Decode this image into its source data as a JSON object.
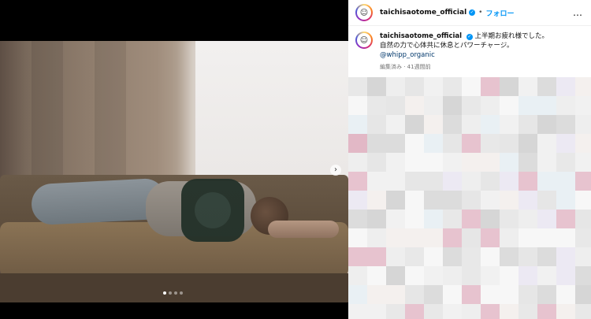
{
  "post": {
    "username": "taichisaotome_official",
    "separator": "•",
    "follow_label": "フォロー",
    "more_icon": "…",
    "caption_line1": "上半期お疲れ様でした。",
    "caption_line2": "自然の力で心体共に休息とパワーチャージ。",
    "mention": "@whipp_organic",
    "meta": "編集済み · 41週間前"
  },
  "media": {
    "next_arrow": "›",
    "slide_count": 4,
    "active_slide": 1
  },
  "colors": {
    "accent": "#0095f6",
    "verified": "#0095f6"
  }
}
